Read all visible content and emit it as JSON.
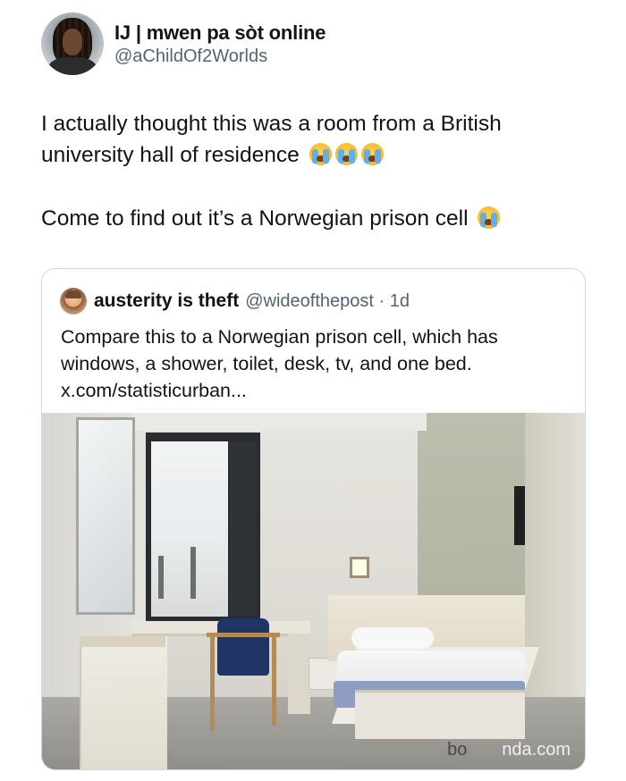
{
  "author": {
    "display_name": "IJ | mwen pa sòt online",
    "handle": "@aChildOf2Worlds",
    "avatar_icon": "profile-photo-icon"
  },
  "tweet": {
    "line1": "I actually thought this was a room from a British university hall of residence",
    "line2": "Come to find out it’s a Norwegian prison cell",
    "emoji_icon": "loudly-crying-face-emoji"
  },
  "quoted": {
    "display_name": "austerity is theft",
    "handle": "@wideofthepost · 1d",
    "text": "Compare this to a Norwegian prison cell, which has windows, a shower, toilet, desk, tv, and one bed. x.com/statisticurban..."
  },
  "watermark": {
    "prefix": "bo",
    "suffix": "nda.com"
  }
}
